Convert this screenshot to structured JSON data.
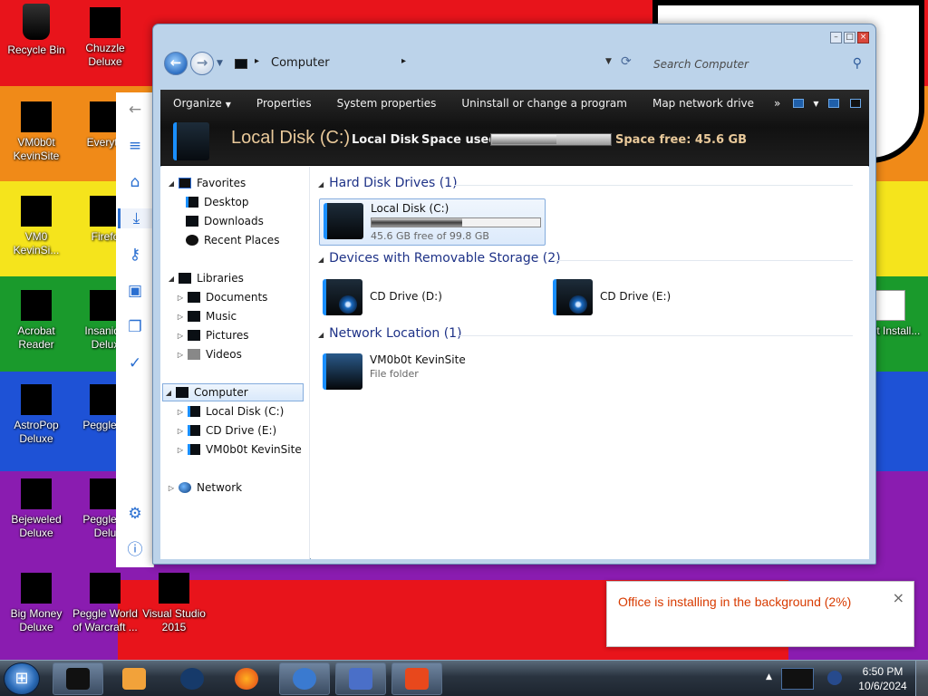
{
  "desktop": {
    "icons": [
      {
        "name": "recycle-bin",
        "label": "Recycle Bin"
      },
      {
        "name": "chuzzle",
        "label": "Chuzzle Deluxe"
      },
      {
        "name": "vm0b0t-1",
        "label": "VM0b0t KevinSite"
      },
      {
        "name": "everything",
        "label": "Everyth"
      },
      {
        "name": "vm0-2",
        "label": "VM0 KevinSi..."
      },
      {
        "name": "firefox",
        "label": "Firefo"
      },
      {
        "name": "acrobat",
        "label": "Acrobat Reader"
      },
      {
        "name": "insaniquarium",
        "label": "Insaniqu Delux"
      },
      {
        "name": "astropop",
        "label": "AstroPop Deluxe"
      },
      {
        "name": "peggle",
        "label": "Peggle D"
      },
      {
        "name": "bejeweled",
        "label": "Bejeweled Deluxe"
      },
      {
        "name": "peggle-nights",
        "label": "Peggle N Delu"
      },
      {
        "name": "big-money",
        "label": "Big Money Deluxe"
      },
      {
        "name": "peggle-world",
        "label": "Peggle World of Warcraft ..."
      },
      {
        "name": "visual-studio",
        "label": "Visual Studio 2015"
      },
      {
        "name": "qbit",
        "label": "Qbit Install..."
      }
    ]
  },
  "window": {
    "address": "Computer",
    "search_placeholder": "Search Computer",
    "toolbar": {
      "organize": "Organize",
      "properties": "Properties",
      "system_properties": "System properties",
      "uninstall": "Uninstall or change a program",
      "map_drive": "Map network drive",
      "more": "»"
    },
    "details": {
      "title": "Local Disk (C:)",
      "type": "Local Disk",
      "space_used_label": "Space used:",
      "space_used_fraction": 0.54,
      "space_free": "Space free: 45.6 GB"
    },
    "nav": {
      "favorites": "Favorites",
      "desktop": "Desktop",
      "downloads": "Downloads",
      "recent": "Recent Places",
      "libraries": "Libraries",
      "documents": "Documents",
      "music": "Music",
      "pictures": "Pictures",
      "videos": "Videos",
      "computer": "Computer",
      "local_disk": "Local Disk (C:)",
      "cd_drive": "CD Drive (E:)",
      "vm0b0t": "VM0b0t KevinSite",
      "network": "Network"
    },
    "groups": {
      "hdd": "Hard Disk Drives (1)",
      "removable": "Devices with Removable Storage (2)",
      "network": "Network Location (1)"
    },
    "items": {
      "local_disk": {
        "name": "Local Disk (C:)",
        "free": "45.6 GB free of 99.8 GB",
        "used_fraction": 0.54
      },
      "cd_d": {
        "name": "CD Drive (D:)"
      },
      "cd_e": {
        "name": "CD Drive (E:)"
      },
      "vm0b0t": {
        "name": "VM0b0t KevinSite",
        "type": "File folder"
      }
    }
  },
  "toast": {
    "message": "Office is installing in the background (2%)",
    "close": "×"
  },
  "clock": {
    "time": "6:50 PM",
    "date": "10/6/2024"
  }
}
